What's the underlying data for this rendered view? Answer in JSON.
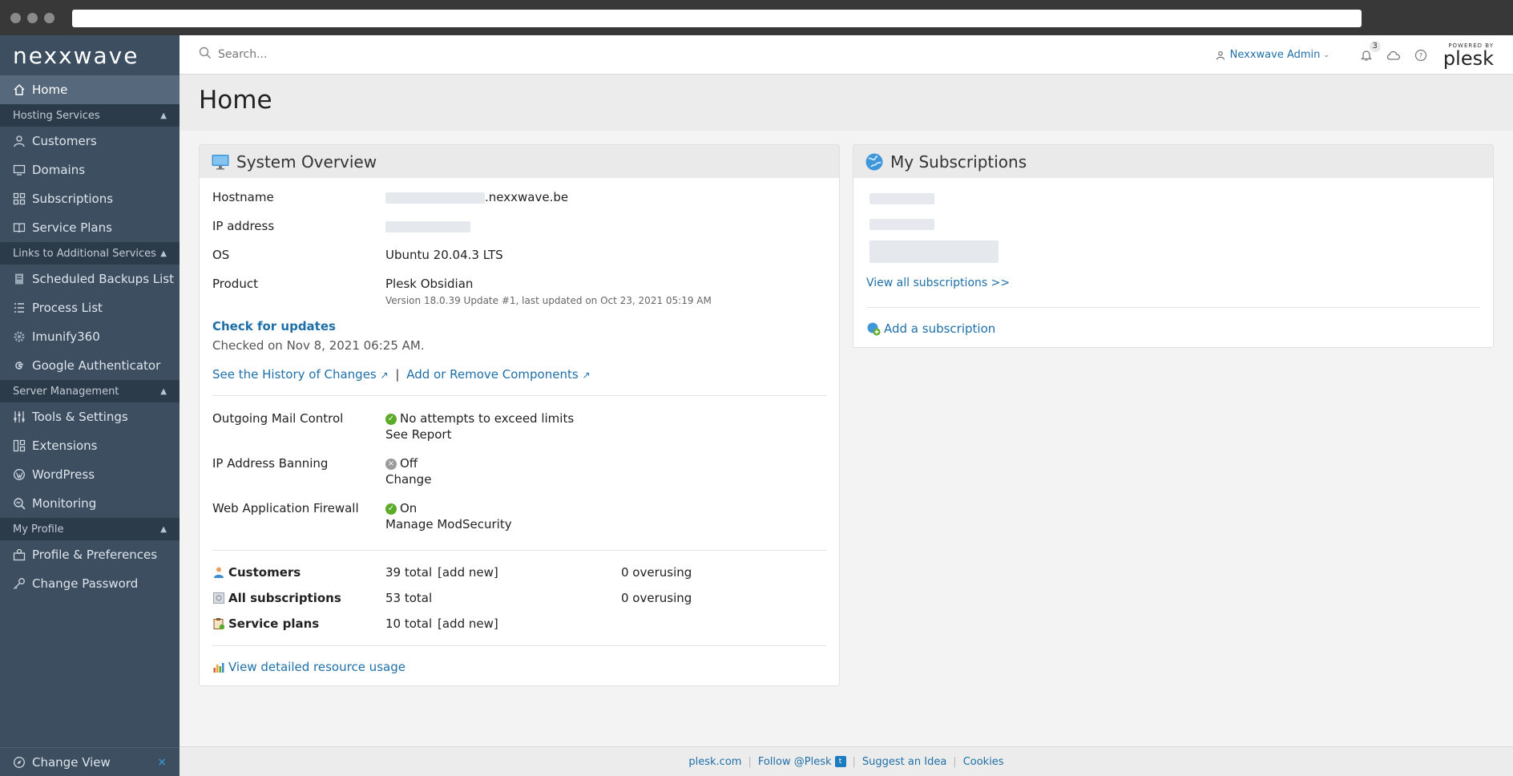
{
  "brand": {
    "logo_text": "Nexxwave"
  },
  "sidebar": {
    "home": "Home",
    "sections": [
      {
        "title": "Hosting Services",
        "items": [
          "Customers",
          "Domains",
          "Subscriptions",
          "Service Plans"
        ]
      },
      {
        "title": "Links to Additional Services",
        "items": [
          "Scheduled Backups List",
          "Process List",
          "Imunify360",
          "Google Authenticator"
        ]
      },
      {
        "title": "Server Management",
        "items": [
          "Tools & Settings",
          "Extensions",
          "WordPress",
          "Monitoring"
        ]
      },
      {
        "title": "My Profile",
        "items": [
          "Profile & Preferences",
          "Change Password"
        ]
      }
    ],
    "change_view": "Change View"
  },
  "topbar": {
    "search_placeholder": "Search...",
    "user_label": "Nexxwave Admin",
    "notifications_count": "3",
    "powered_by": "POWERED BY",
    "plesk": "plesk"
  },
  "page": {
    "title": "Home"
  },
  "system_overview": {
    "title": "System Overview",
    "hostname_label": "Hostname",
    "hostname_value": ".nexxwave.be",
    "ip_label": "IP address",
    "os_label": "OS",
    "os_value": "Ubuntu 20.04.3 LTS",
    "product_label": "Product",
    "product_value": "Plesk Obsidian",
    "product_version": "Version 18.0.39 Update #1, last updated on Oct 23, 2021 05:19 AM",
    "check_updates": "Check for updates",
    "checked_on": "Checked on Nov 8, 2021 06:25 AM.",
    "history_link": "See the History of Changes",
    "divider": "|",
    "components_link": "Add or Remove Components",
    "mail_label": "Outgoing Mail Control",
    "mail_status": "No attempts to exceed limits",
    "mail_link": "See Report",
    "ipban_label": "IP Address Banning",
    "ipban_status": "Off",
    "ipban_link": "Change",
    "waf_label": "Web Application Firewall",
    "waf_status": "On",
    "waf_link": "Manage ModSecurity",
    "stats": [
      {
        "label": "Customers",
        "total": "39 total",
        "add": "[add new]",
        "overusing": "0 overusing"
      },
      {
        "label": "All subscriptions",
        "total": "53 total",
        "add": "",
        "overusing": "0 overusing"
      },
      {
        "label": "Service plans",
        "total": "10 total",
        "add": "[add new]",
        "overusing": ""
      }
    ],
    "resource_link": "View detailed resource usage"
  },
  "subscriptions": {
    "title": "My Subscriptions",
    "view_all": "View all subscriptions >>",
    "add": "Add a subscription"
  },
  "footer": {
    "links": [
      "plesk.com",
      "Follow @Plesk",
      "Suggest an Idea",
      "Cookies"
    ]
  }
}
